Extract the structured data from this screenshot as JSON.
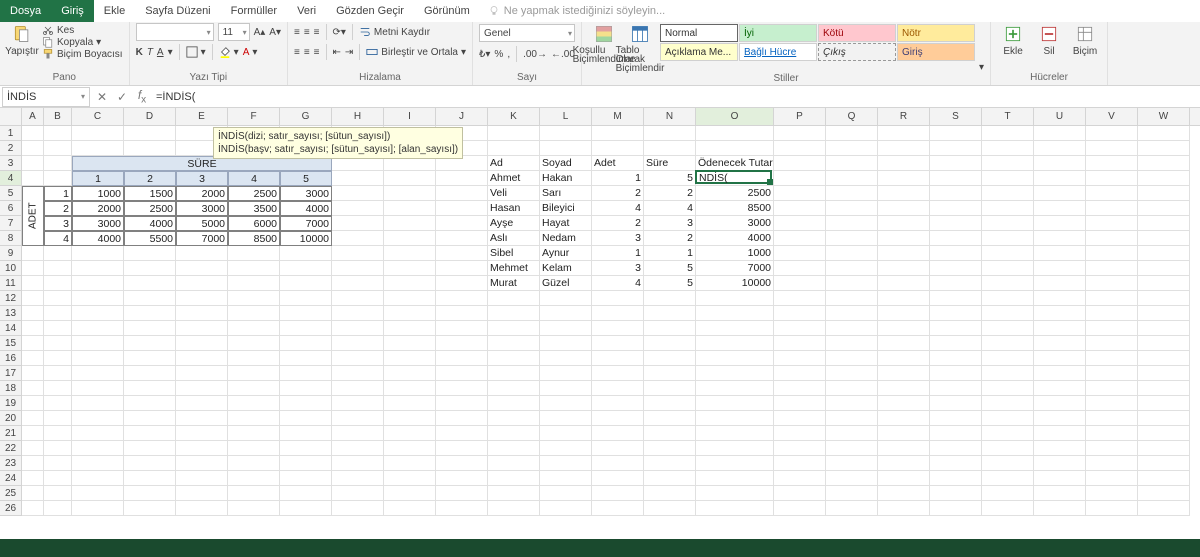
{
  "tabs": {
    "file": "Dosya",
    "home": "Giriş",
    "insert": "Ekle",
    "layout": "Sayfa Düzeni",
    "formulas": "Formüller",
    "data": "Veri",
    "review": "Gözden Geçir",
    "view": "Görünüm",
    "tellme": "Ne yapmak istediğinizi söyleyin..."
  },
  "ribbon": {
    "clipboard": {
      "cut": "Kes",
      "copy": "Kopyala",
      "painter": "Biçim Boyacısı",
      "paste": "Yapıştır",
      "label": "Pano"
    },
    "font": {
      "name": "",
      "size": "11",
      "label": "Yazı Tipi",
      "boldK": "K",
      "italicT": "T",
      "underlineA": "A"
    },
    "alignment": {
      "wrap": "Metni Kaydır",
      "merge": "Birleştir ve Ortala",
      "label": "Hizalama"
    },
    "number": {
      "general": "Genel",
      "label": "Sayı"
    },
    "styles": {
      "cond": "Koşullu Biçimlendirme",
      "table": "Tablo Olarak Biçimlendir",
      "normal": "Normal",
      "good": "İyi",
      "bad": "Kötü",
      "neutral": "Nötr",
      "note": "Açıklama Me...",
      "link": "Bağlı Hücre",
      "output": "Çıkış",
      "input": "Giriş",
      "label": "Stiller"
    },
    "cells": {
      "insert": "Ekle",
      "delete": "Sil",
      "format": "Biçim",
      "label": "Hücreler"
    }
  },
  "formula_bar": {
    "name": "İNDİS",
    "formula": "=İNDİS("
  },
  "tooltip": {
    "line1": "İNDİS(dizi; satır_sayısı; [sütun_sayısı])",
    "line2": "İNDİS(başv; satır_sayısı; [sütun_sayısı]; [alan_sayısı])"
  },
  "columns": [
    "A",
    "B",
    "C",
    "D",
    "E",
    "F",
    "G",
    "H",
    "I",
    "J",
    "K",
    "L",
    "M",
    "N",
    "O",
    "P",
    "Q",
    "R",
    "S",
    "T",
    "U",
    "V",
    "W"
  ],
  "col_widths": {
    "A": 22,
    "B": 28,
    "C": 52,
    "D": 52,
    "E": 52,
    "F": 52,
    "G": 52,
    "H": 52,
    "I": 52,
    "J": 52,
    "K": 52,
    "L": 52,
    "M": 52,
    "N": 52,
    "O": 78,
    "P": 52,
    "Q": 52,
    "R": 52,
    "S": 52,
    "T": 52,
    "U": 52,
    "V": 52,
    "W": 52
  },
  "row_labels": [
    "1",
    "2",
    "3",
    "4",
    "5",
    "6",
    "7",
    "8",
    "9",
    "10",
    "11",
    "12",
    "13",
    "14",
    "15",
    "16",
    "17",
    "18",
    "19",
    "20",
    "21",
    "22",
    "23",
    "24",
    "25",
    "26"
  ],
  "active": {
    "col": "O",
    "row": 4,
    "display": "NDİS("
  },
  "merged": {
    "sure": "SÜRE",
    "adet": "ADET"
  },
  "sure_cols": {
    "c1": "1",
    "c2": "2",
    "c3": "3",
    "c4": "4",
    "c5": "5"
  },
  "adet_rows": {
    "r1": "1",
    "r2": "2",
    "r3": "3",
    "r4": "4"
  },
  "matrix": [
    [
      "1000",
      "1500",
      "2000",
      "2500",
      "3000"
    ],
    [
      "2000",
      "2500",
      "3000",
      "3500",
      "4000"
    ],
    [
      "3000",
      "4000",
      "5000",
      "6000",
      "7000"
    ],
    [
      "4000",
      "5500",
      "7000",
      "8500",
      "10000"
    ]
  ],
  "headers2": {
    "ad": "Ad",
    "soyad": "Soyad",
    "adet": "Adet",
    "sure": "Süre",
    "tutar": "Ödenecek Tutar"
  },
  "people": [
    {
      "ad": "Ahmet",
      "soyad": "Hakan",
      "adet": "1",
      "sure": "5",
      "tutar": ""
    },
    {
      "ad": "Veli",
      "soyad": "Sarı",
      "adet": "2",
      "sure": "2",
      "tutar": "2500"
    },
    {
      "ad": "Hasan",
      "soyad": "Bileyici",
      "adet": "4",
      "sure": "4",
      "tutar": "8500"
    },
    {
      "ad": "Ayşe",
      "soyad": "Hayat",
      "adet": "2",
      "sure": "3",
      "tutar": "3000"
    },
    {
      "ad": "Aslı",
      "soyad": "Nedam",
      "adet": "3",
      "sure": "2",
      "tutar": "4000"
    },
    {
      "ad": "Sibel",
      "soyad": "Aynur",
      "adet": "1",
      "sure": "1",
      "tutar": "1000"
    },
    {
      "ad": "Mehmet",
      "soyad": "Kelam",
      "adet": "3",
      "sure": "5",
      "tutar": "7000"
    },
    {
      "ad": "Murat",
      "soyad": "Güzel",
      "adet": "4",
      "sure": "5",
      "tutar": "10000"
    }
  ]
}
